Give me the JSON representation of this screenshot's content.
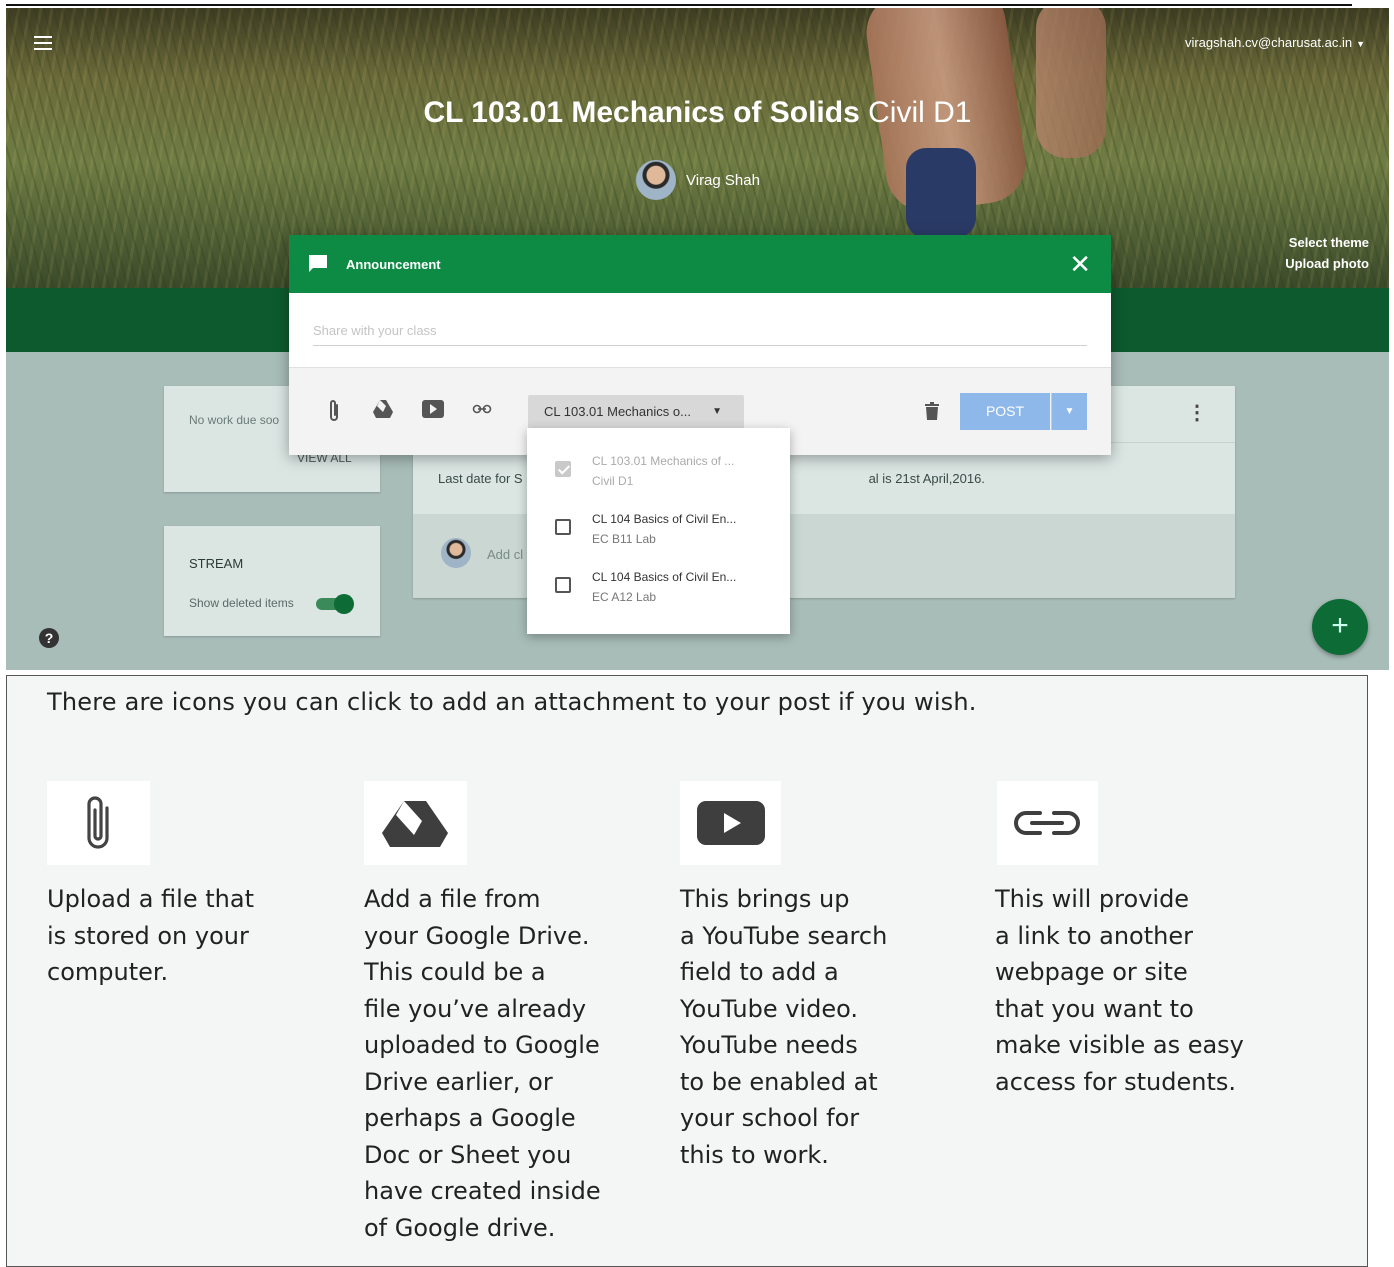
{
  "header": {
    "account_email": "viragshah.cv@charusat.ac.in",
    "course_title_bold": "CL 103.01 Mechanics of Solids",
    "course_section": "Civil D1",
    "teacher_name": "Virag Shah",
    "select_theme": "Select theme",
    "upload_photo": "Upload photo"
  },
  "sidebar": {
    "upcoming_text": "No work due soo",
    "view_all": "VIEW ALL",
    "stream_title": "STREAM",
    "show_deleted": "Show deleted items"
  },
  "post": {
    "text_left": "Last date for S",
    "text_right": "al is 21st April,2016.",
    "add_comment": "Add cl"
  },
  "dialog": {
    "title": "Announcement",
    "share_placeholder": "Share with your class",
    "class_select": "CL 103.01 Mechanics o...",
    "post_button": "POST"
  },
  "class_options": [
    {
      "line1": "CL 103.01 Mechanics of ...",
      "line2": "Civil D1",
      "checked": true
    },
    {
      "line1": "CL 104 Basics of Civil En...",
      "line2": "EC B11 Lab",
      "checked": false
    },
    {
      "line1": "CL 104 Basics of Civil En...",
      "line2": "EC A12 Lab",
      "checked": false
    }
  ],
  "doc": {
    "intro": "There are icons you can click to add an attachment to your post if you wish.",
    "columns": [
      {
        "icon": "paperclip-icon",
        "lines": [
          "Upload a file that",
          "is stored on your",
          "computer."
        ]
      },
      {
        "icon": "google-drive-icon",
        "lines": [
          "Add a file from",
          "your Google Drive.",
          "This could be a",
          "file you’ve already",
          "uploaded to Google",
          "Drive earlier, or",
          "perhaps a Google",
          "Doc or Sheet you",
          "have created inside",
          "of Google drive."
        ]
      },
      {
        "icon": "youtube-icon",
        "lines": [
          "This brings up",
          "a YouTube search",
          "field to add a",
          "YouTube video.",
          "YouTube needs",
          "to be enabled at",
          "your school for",
          "this to work."
        ]
      },
      {
        "icon": "link-icon",
        "lines": [
          "This will provide",
          "a link to another",
          "webpage or site",
          "that you want to",
          "make visible as easy",
          "access for students."
        ]
      }
    ]
  },
  "colors": {
    "header_green": "#0d8a44",
    "band_green": "#0d5a2e",
    "post_blue": "#8fb8ea",
    "fab_green": "#0d6b36"
  }
}
